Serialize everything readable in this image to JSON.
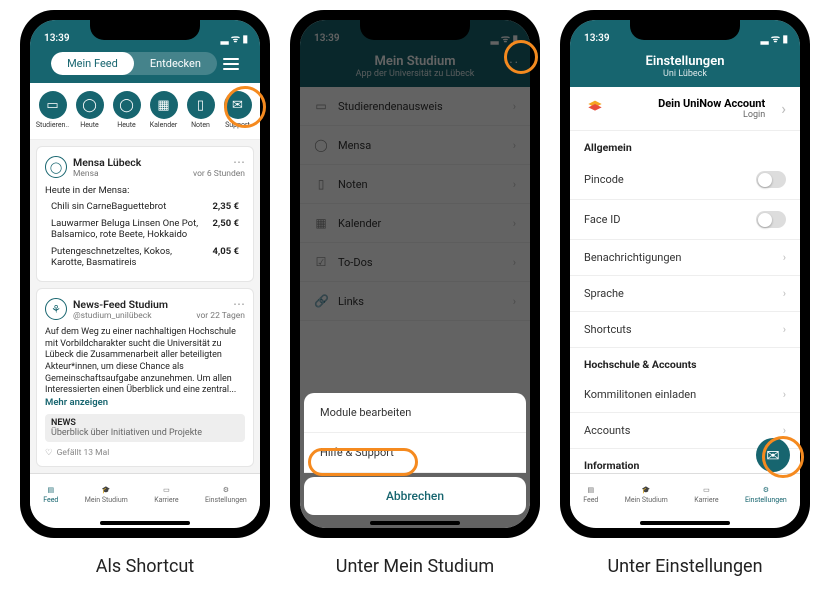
{
  "time": "13:39",
  "status_icons": "▮ ᯤ ▮",
  "phone1": {
    "tabs": {
      "feed": "Mein Feed",
      "discover": "Entdecken"
    },
    "shortcuts": [
      {
        "label": "Studieren..",
        "glyph": "▭"
      },
      {
        "label": "Heute",
        "glyph": "◯"
      },
      {
        "label": "Heute",
        "glyph": "◯"
      },
      {
        "label": "Kalender",
        "glyph": "▦"
      },
      {
        "label": "Noten",
        "glyph": "▯"
      },
      {
        "label": "Support",
        "glyph": "✉"
      }
    ],
    "mensa": {
      "title": "Mensa Lübeck",
      "sub": "Mensa",
      "time": "vor 6 Stunden",
      "intro": "Heute in der Mensa:",
      "items": [
        {
          "name": "Chili sin CarneBaguettebrot",
          "price": "2,35 €"
        },
        {
          "name": "Lauwarmer Beluga Linsen One Pot, Balsamico, rote Beete, Hokkaido",
          "price": "2,50 €"
        },
        {
          "name": "Putengeschnetzeltes, Kokos, Karotte, Basmatireis",
          "price": "4,05 €"
        }
      ]
    },
    "news": {
      "title": "News-Feed Studium",
      "handle": "@studium_unilübeck",
      "time": "vor 22 Tagen",
      "body": "Auf dem Weg zu einer nachhaltigen Hochschule mit Vorbildcharakter sucht die Universität zu Lübeck die Zusammenarbeit aller beteiligten Akteur*innen, um diese Chance als Gemeinschaftsaufgabe anzunehmen. Um allen Interessierten einen Überblick und eine zentral...",
      "more": "Mehr anzeigen",
      "tag_title": "NEWS",
      "tag_sub": "Überblick über Initiativen und Projekte",
      "likes": "Gefällt 13 Mal"
    },
    "nav": {
      "feed": "Feed",
      "studium": "Mein Studium",
      "karriere": "Karriere",
      "settings": "Einstellungen"
    }
  },
  "phone2": {
    "title": "Mein Studium",
    "subtitle": "App der Universität zu Lübeck",
    "list": [
      {
        "icon": "▭",
        "label": "Studierendenausweis"
      },
      {
        "icon": "◯",
        "label": "Mensa"
      },
      {
        "icon": "▯",
        "label": "Noten"
      },
      {
        "icon": "▦",
        "label": "Kalender"
      },
      {
        "icon": "☑",
        "label": "To-Dos"
      },
      {
        "icon": "🔗",
        "label": "Links"
      }
    ],
    "sheet": {
      "edit": "Module bearbeiten",
      "help": "Hilfe & Support",
      "cancel": "Abbrechen"
    }
  },
  "phone3": {
    "title": "Einstellungen",
    "subtitle": "Uni Lübeck",
    "account": {
      "title": "Dein UniNow Account",
      "sub": "Login"
    },
    "sections": {
      "general": "Allgemein",
      "hoch": "Hochschule & Accounts",
      "info": "Information"
    },
    "rows": {
      "pincode": "Pincode",
      "faceid": "Face ID",
      "notif": "Benachrichtigungen",
      "lang": "Sprache",
      "shortcuts": "Shortcuts",
      "invite": "Kommilitonen einladen",
      "accounts": "Accounts"
    }
  },
  "captions": {
    "c1": "Als Shortcut",
    "c2": "Unter Mein Studium",
    "c3": "Unter Einstellungen"
  }
}
